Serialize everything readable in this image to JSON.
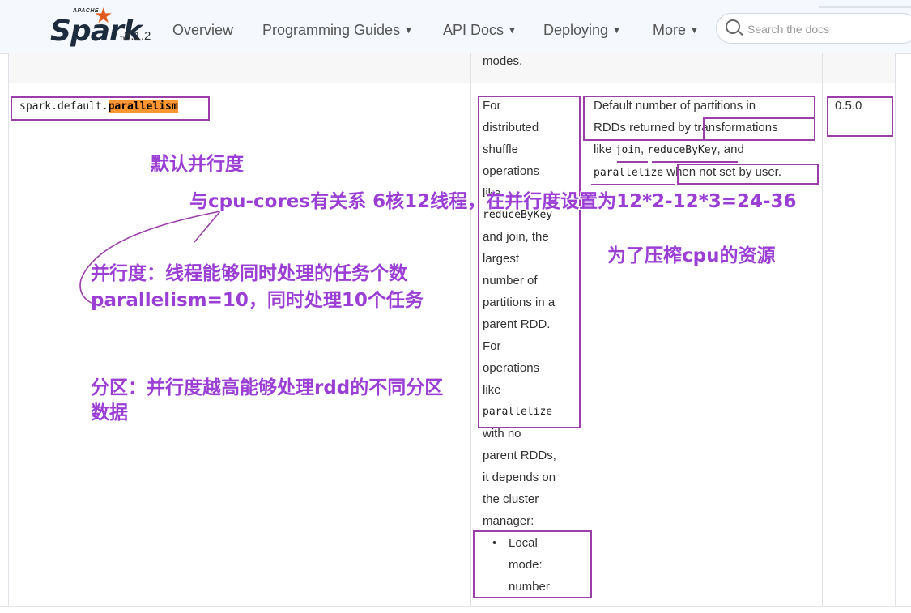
{
  "navbar": {
    "logo_apache": "APACHE",
    "logo_word": "Spark",
    "logo_tm": "TM",
    "version": "3.1.2",
    "items": [
      {
        "label": "Overview",
        "dropdown": false
      },
      {
        "label": "Programming Guides",
        "dropdown": true
      },
      {
        "label": "API Docs",
        "dropdown": true
      },
      {
        "label": "Deploying",
        "dropdown": true
      },
      {
        "label": "More",
        "dropdown": true
      }
    ],
    "search_placeholder": "Search the docs"
  },
  "table": {
    "prev_row_text": "modes.",
    "row": {
      "property_prefix": "spark.default.",
      "property_highlight": "parallelism",
      "default_lines": [
        "For",
        "distributed",
        "shuffle",
        "operations",
        "like",
        "reduceByKey",
        "and join, the",
        "largest",
        "number of",
        "partitions in a",
        "parent RDD.",
        "For",
        "operations",
        "like",
        "parallelize",
        "with no",
        "parent RDDs,",
        "it depends on",
        "the cluster",
        "manager:"
      ],
      "default_bullet_lines": [
        "Local",
        "mode:",
        "number"
      ],
      "meaning": {
        "line1": "Default number of partitions in",
        "line2_a": "RDDs returned by ",
        "line2_b": "transformations",
        "line3_a": "like ",
        "line3_code1": "join",
        "line3_b": ", ",
        "line3_code2": "reduceByKey",
        "line3_c": ", and",
        "line4_code": "parallelize",
        "line4_b": " when not set by user."
      },
      "since": "0.5.0"
    }
  },
  "annotations": {
    "a1": "默认并行度",
    "a2": "与cpu-cores有关系  6核12线程，在并行度设置为12*2-12*3=24-36",
    "a3": "为了压榨cpu的资源",
    "a4_line1": "并行度：线程能够同时处理的任务个数",
    "a4_line2": "parallelism=10，同时处理10个任务",
    "a5_line1": "分区：并行度越高能够处理rdd的不同分区",
    "a5_line2": "数据",
    "color": "#9b3fd4",
    "box_color": "#9b3fa8"
  },
  "colors": {
    "navbar_bg": "#f5f8fd",
    "highlight": "#ff9632",
    "spark_orange": "#e25a1c"
  }
}
